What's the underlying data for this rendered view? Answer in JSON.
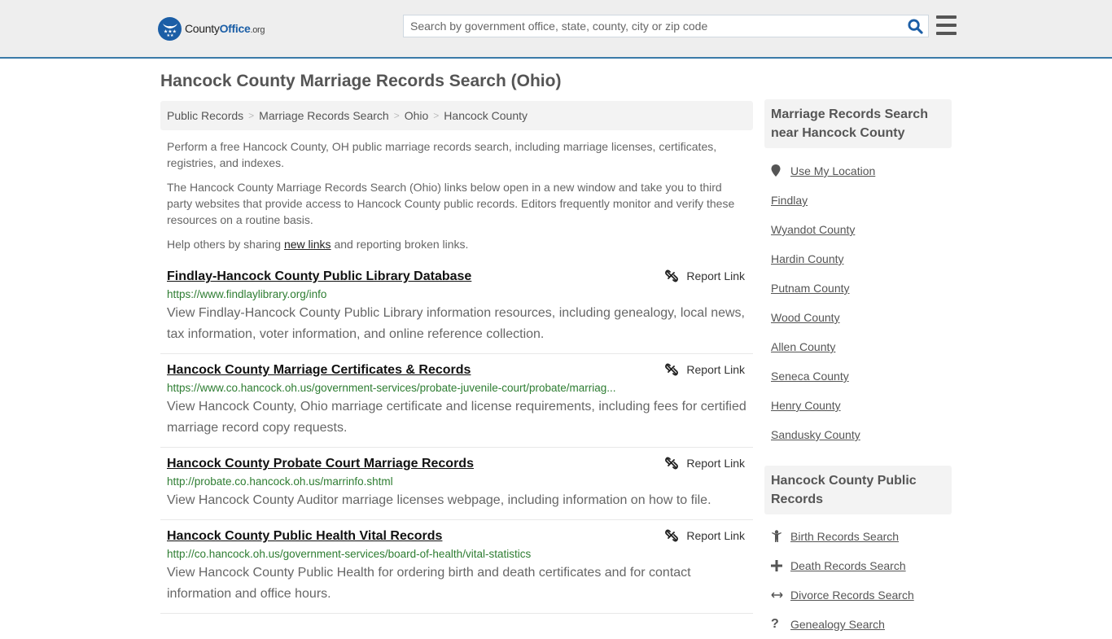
{
  "header": {
    "logo": {
      "name_part1": "County",
      "name_part2": "Office",
      "tld": ".org"
    },
    "search": {
      "placeholder": "Search by government office, state, county, city or zip code",
      "value": ""
    },
    "icons": {
      "search": "search-icon",
      "menu": "hamburger-menu-icon"
    }
  },
  "page": {
    "title": "Hancock County Marriage Records Search (Ohio)",
    "breadcrumb": [
      {
        "label": "Public Records"
      },
      {
        "label": "Marriage Records Search"
      },
      {
        "label": "Ohio"
      },
      {
        "label": "Hancock County"
      }
    ],
    "breadcrumb_separator": ">",
    "intro": {
      "p1": "Perform a free Hancock County, OH public marriage records search, including marriage licenses, certificates, registries, and indexes.",
      "p2": "The Hancock County Marriage Records Search (Ohio) links below open in a new window and take you to third party websites that provide access to Hancock County public records. Editors frequently monitor and verify these resources on a routine basis.",
      "p3_before": "Help others by sharing ",
      "p3_link": "new links",
      "p3_after": " and reporting broken links."
    }
  },
  "results": [
    {
      "title": "Findlay-Hancock County Public Library Database",
      "url": "https://www.findlaylibrary.org/info",
      "description": "View Findlay-Hancock County Public Library information resources, including genealogy, local news, tax information, voter information, and online reference collection.",
      "report_label": "Report Link"
    },
    {
      "title": "Hancock County Marriage Certificates & Records",
      "url": "https://www.co.hancock.oh.us/government-services/probate-juvenile-court/probate/marriag...",
      "description": "View Hancock County, Ohio marriage certificate and license requirements, including fees for certified marriage record copy requests.",
      "report_label": "Report Link"
    },
    {
      "title": "Hancock County Probate Court Marriage Records",
      "url": "http://probate.co.hancock.oh.us/marrinfo.shtml",
      "description": "View Hancock County Auditor marriage licenses webpage, including information on how to file.",
      "report_label": "Report Link"
    },
    {
      "title": "Hancock County Public Health Vital Records",
      "url": "http://co.hancock.oh.us/government-services/board-of-health/vital-statistics",
      "description": "View Hancock County Public Health for ordering birth and death certificates and for contact information and office hours.",
      "report_label": "Report Link"
    }
  ],
  "sidebar": {
    "nearby": {
      "heading": "Marriage Records Search near Hancock County",
      "use_location": "Use My Location",
      "items": [
        "Findlay",
        "Wyandot County",
        "Hardin County",
        "Putnam County",
        "Wood County",
        "Allen County",
        "Seneca County",
        "Henry County",
        "Sandusky County"
      ]
    },
    "public_records": {
      "heading": "Hancock County Public Records",
      "items": [
        {
          "label": "Birth Records Search",
          "icon": "child-icon"
        },
        {
          "label": "Death Records Search",
          "icon": "cross-icon"
        },
        {
          "label": "Divorce Records Search",
          "icon": "arrows-horizontal-icon"
        },
        {
          "label": "Genealogy Search",
          "icon": "question-icon"
        }
      ]
    }
  },
  "colors": {
    "header_bg": "#eeeeee",
    "header_border": "#3a7aa8",
    "brand_blue": "#1b5ea6",
    "url_green": "#2e7d32",
    "box_bg": "#f3f3f3"
  }
}
